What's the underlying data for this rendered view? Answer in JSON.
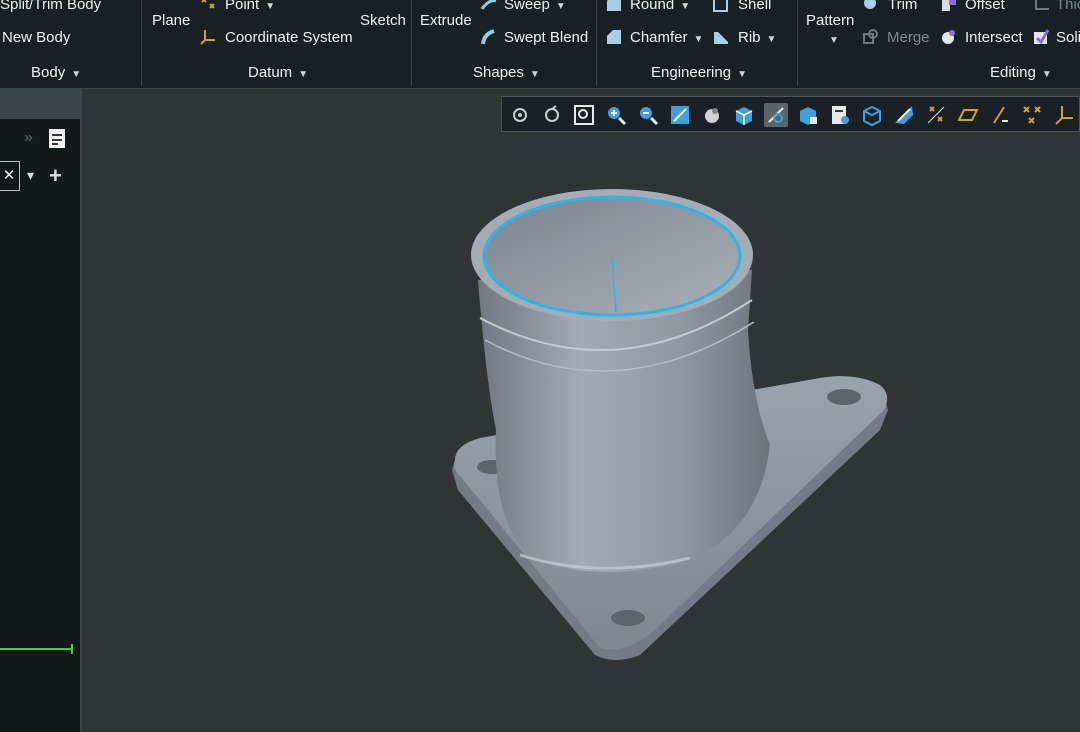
{
  "ribbon": {
    "body_group": {
      "split_trim_body": "Split/Trim Body",
      "new_body": "New Body",
      "label": "Body"
    },
    "datum_group": {
      "plane": "Plane",
      "point": "Point",
      "coordinate_system": "Coordinate System",
      "sketch": "Sketch",
      "label": "Datum"
    },
    "shapes_group": {
      "extrude": "Extrude",
      "sweep": "Sweep",
      "swept_blend": "Swept Blend",
      "label": "Shapes"
    },
    "engineering_group": {
      "round": "Round",
      "shell": "Shell",
      "chamfer": "Chamfer",
      "rib": "Rib",
      "label": "Engineering"
    },
    "editing_group": {
      "pattern": "Pattern",
      "trim": "Trim",
      "offset": "Offset",
      "thicken": "Thic",
      "merge": "Merge",
      "intersect": "Intersect",
      "solidify": "Soli",
      "label": "Editing"
    }
  },
  "left_panel": {
    "close_glyph": "✕",
    "dropdown_glyph": "▾",
    "add_glyph": "+",
    "expand_glyph": "»"
  },
  "view_toolbar": {
    "icons": [
      "refit-icon",
      "repaint-icon",
      "zoom-to-fit-icon",
      "zoom-in-icon",
      "zoom-out-icon",
      "sketch-view-icon",
      "appearance-icon",
      "named-views-icon",
      "display-style-icon",
      "perspective-icon",
      "section-icon",
      "saved-orientations-icon",
      "view-manager-icon",
      "datum-display-icon",
      "plane-display-icon",
      "axis-display-icon",
      "point-display-icon",
      "csys-display-icon"
    ]
  },
  "colors": {
    "ribbon_bg": "#182024",
    "viewport_bg": "#2f3535",
    "part_fill": "#8f98a2",
    "highlight": "#2fb5e6",
    "accent_green": "#49c94a"
  }
}
